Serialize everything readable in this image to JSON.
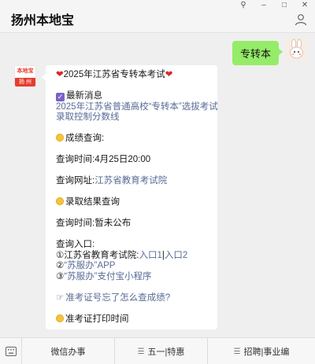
{
  "window": {
    "title": "扬州本地宝",
    "controls": [
      "⚲",
      "–",
      "□",
      "✕"
    ]
  },
  "chat": {
    "user_message": "专转本",
    "bot_avatar": {
      "top": "本地宝",
      "bottom": "扬 州"
    },
    "bot_message": {
      "title": "2025年江苏省专转本考试",
      "news_label": "最新消息",
      "news_link_line1": "2025年江苏省普通高校“专转本”选拔考试",
      "news_link_line2": "录取控制分数线",
      "score_query_heading": "成绩查询:",
      "query_time_label": "查询时间:",
      "query_time_value": "4月25日20:00",
      "query_site_label": "查询网址:",
      "query_site_link": "江苏省教育考试院",
      "admission_heading": "录取结果查询",
      "admission_time_label": "查询时间:",
      "admission_time_value": "暂未公布",
      "entry_label": "查询入口:",
      "entry1_prefix": "①江苏省教育考试院:",
      "entry1_link_a": "入口1",
      "entry1_sep": "|",
      "entry1_link_b": "入口2",
      "entry2_prefix": "②",
      "entry2_link": "“苏服办”APP",
      "entry3_prefix": "③",
      "entry3_link": "“苏服办”支付宝小程序",
      "forgot_link": "准考证号忘了怎么查成绩?",
      "print_heading": "准考证打印时间"
    }
  },
  "menu": {
    "items": [
      "微信办事",
      "五一|特惠",
      "招聘|事业编"
    ]
  },
  "colors": {
    "link": "#576b95",
    "user_bubble": "#95ec69",
    "brand_red": "#e63d2e"
  },
  "icons": [
    "search-icon",
    "minimize-icon",
    "maximize-icon",
    "close-icon",
    "profile-icon",
    "keyboard-icon",
    "menu-lines-icon"
  ]
}
